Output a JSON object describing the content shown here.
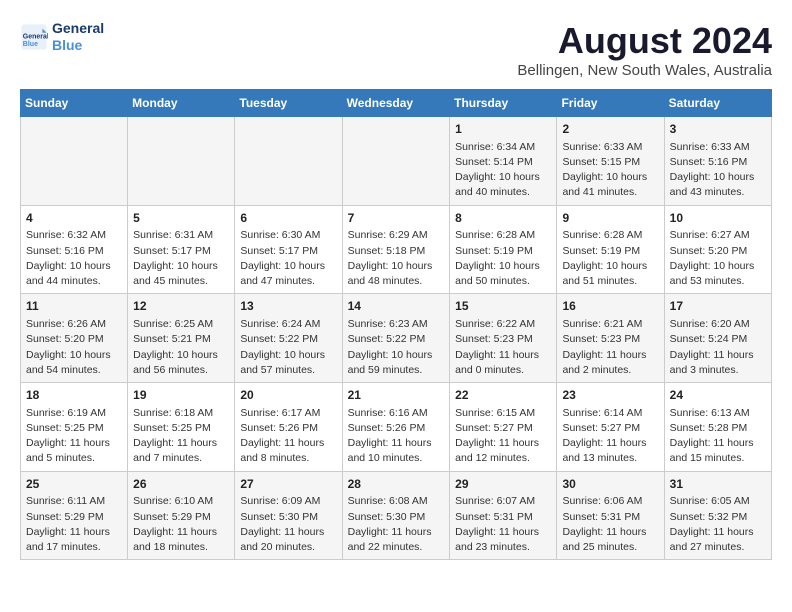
{
  "logo": {
    "line1": "General",
    "line2": "Blue"
  },
  "title": "August 2024",
  "subtitle": "Bellingen, New South Wales, Australia",
  "days_of_week": [
    "Sunday",
    "Monday",
    "Tuesday",
    "Wednesday",
    "Thursday",
    "Friday",
    "Saturday"
  ],
  "weeks": [
    [
      {
        "day": "",
        "content": ""
      },
      {
        "day": "",
        "content": ""
      },
      {
        "day": "",
        "content": ""
      },
      {
        "day": "",
        "content": ""
      },
      {
        "day": "1",
        "content": "Sunrise: 6:34 AM\nSunset: 5:14 PM\nDaylight: 10 hours and 40 minutes."
      },
      {
        "day": "2",
        "content": "Sunrise: 6:33 AM\nSunset: 5:15 PM\nDaylight: 10 hours and 41 minutes."
      },
      {
        "day": "3",
        "content": "Sunrise: 6:33 AM\nSunset: 5:16 PM\nDaylight: 10 hours and 43 minutes."
      }
    ],
    [
      {
        "day": "4",
        "content": "Sunrise: 6:32 AM\nSunset: 5:16 PM\nDaylight: 10 hours and 44 minutes."
      },
      {
        "day": "5",
        "content": "Sunrise: 6:31 AM\nSunset: 5:17 PM\nDaylight: 10 hours and 45 minutes."
      },
      {
        "day": "6",
        "content": "Sunrise: 6:30 AM\nSunset: 5:17 PM\nDaylight: 10 hours and 47 minutes."
      },
      {
        "day": "7",
        "content": "Sunrise: 6:29 AM\nSunset: 5:18 PM\nDaylight: 10 hours and 48 minutes."
      },
      {
        "day": "8",
        "content": "Sunrise: 6:28 AM\nSunset: 5:19 PM\nDaylight: 10 hours and 50 minutes."
      },
      {
        "day": "9",
        "content": "Sunrise: 6:28 AM\nSunset: 5:19 PM\nDaylight: 10 hours and 51 minutes."
      },
      {
        "day": "10",
        "content": "Sunrise: 6:27 AM\nSunset: 5:20 PM\nDaylight: 10 hours and 53 minutes."
      }
    ],
    [
      {
        "day": "11",
        "content": "Sunrise: 6:26 AM\nSunset: 5:20 PM\nDaylight: 10 hours and 54 minutes."
      },
      {
        "day": "12",
        "content": "Sunrise: 6:25 AM\nSunset: 5:21 PM\nDaylight: 10 hours and 56 minutes."
      },
      {
        "day": "13",
        "content": "Sunrise: 6:24 AM\nSunset: 5:22 PM\nDaylight: 10 hours and 57 minutes."
      },
      {
        "day": "14",
        "content": "Sunrise: 6:23 AM\nSunset: 5:22 PM\nDaylight: 10 hours and 59 minutes."
      },
      {
        "day": "15",
        "content": "Sunrise: 6:22 AM\nSunset: 5:23 PM\nDaylight: 11 hours and 0 minutes."
      },
      {
        "day": "16",
        "content": "Sunrise: 6:21 AM\nSunset: 5:23 PM\nDaylight: 11 hours and 2 minutes."
      },
      {
        "day": "17",
        "content": "Sunrise: 6:20 AM\nSunset: 5:24 PM\nDaylight: 11 hours and 3 minutes."
      }
    ],
    [
      {
        "day": "18",
        "content": "Sunrise: 6:19 AM\nSunset: 5:25 PM\nDaylight: 11 hours and 5 minutes."
      },
      {
        "day": "19",
        "content": "Sunrise: 6:18 AM\nSunset: 5:25 PM\nDaylight: 11 hours and 7 minutes."
      },
      {
        "day": "20",
        "content": "Sunrise: 6:17 AM\nSunset: 5:26 PM\nDaylight: 11 hours and 8 minutes."
      },
      {
        "day": "21",
        "content": "Sunrise: 6:16 AM\nSunset: 5:26 PM\nDaylight: 11 hours and 10 minutes."
      },
      {
        "day": "22",
        "content": "Sunrise: 6:15 AM\nSunset: 5:27 PM\nDaylight: 11 hours and 12 minutes."
      },
      {
        "day": "23",
        "content": "Sunrise: 6:14 AM\nSunset: 5:27 PM\nDaylight: 11 hours and 13 minutes."
      },
      {
        "day": "24",
        "content": "Sunrise: 6:13 AM\nSunset: 5:28 PM\nDaylight: 11 hours and 15 minutes."
      }
    ],
    [
      {
        "day": "25",
        "content": "Sunrise: 6:11 AM\nSunset: 5:29 PM\nDaylight: 11 hours and 17 minutes."
      },
      {
        "day": "26",
        "content": "Sunrise: 6:10 AM\nSunset: 5:29 PM\nDaylight: 11 hours and 18 minutes."
      },
      {
        "day": "27",
        "content": "Sunrise: 6:09 AM\nSunset: 5:30 PM\nDaylight: 11 hours and 20 minutes."
      },
      {
        "day": "28",
        "content": "Sunrise: 6:08 AM\nSunset: 5:30 PM\nDaylight: 11 hours and 22 minutes."
      },
      {
        "day": "29",
        "content": "Sunrise: 6:07 AM\nSunset: 5:31 PM\nDaylight: 11 hours and 23 minutes."
      },
      {
        "day": "30",
        "content": "Sunrise: 6:06 AM\nSunset: 5:31 PM\nDaylight: 11 hours and 25 minutes."
      },
      {
        "day": "31",
        "content": "Sunrise: 6:05 AM\nSunset: 5:32 PM\nDaylight: 11 hours and 27 minutes."
      }
    ]
  ]
}
